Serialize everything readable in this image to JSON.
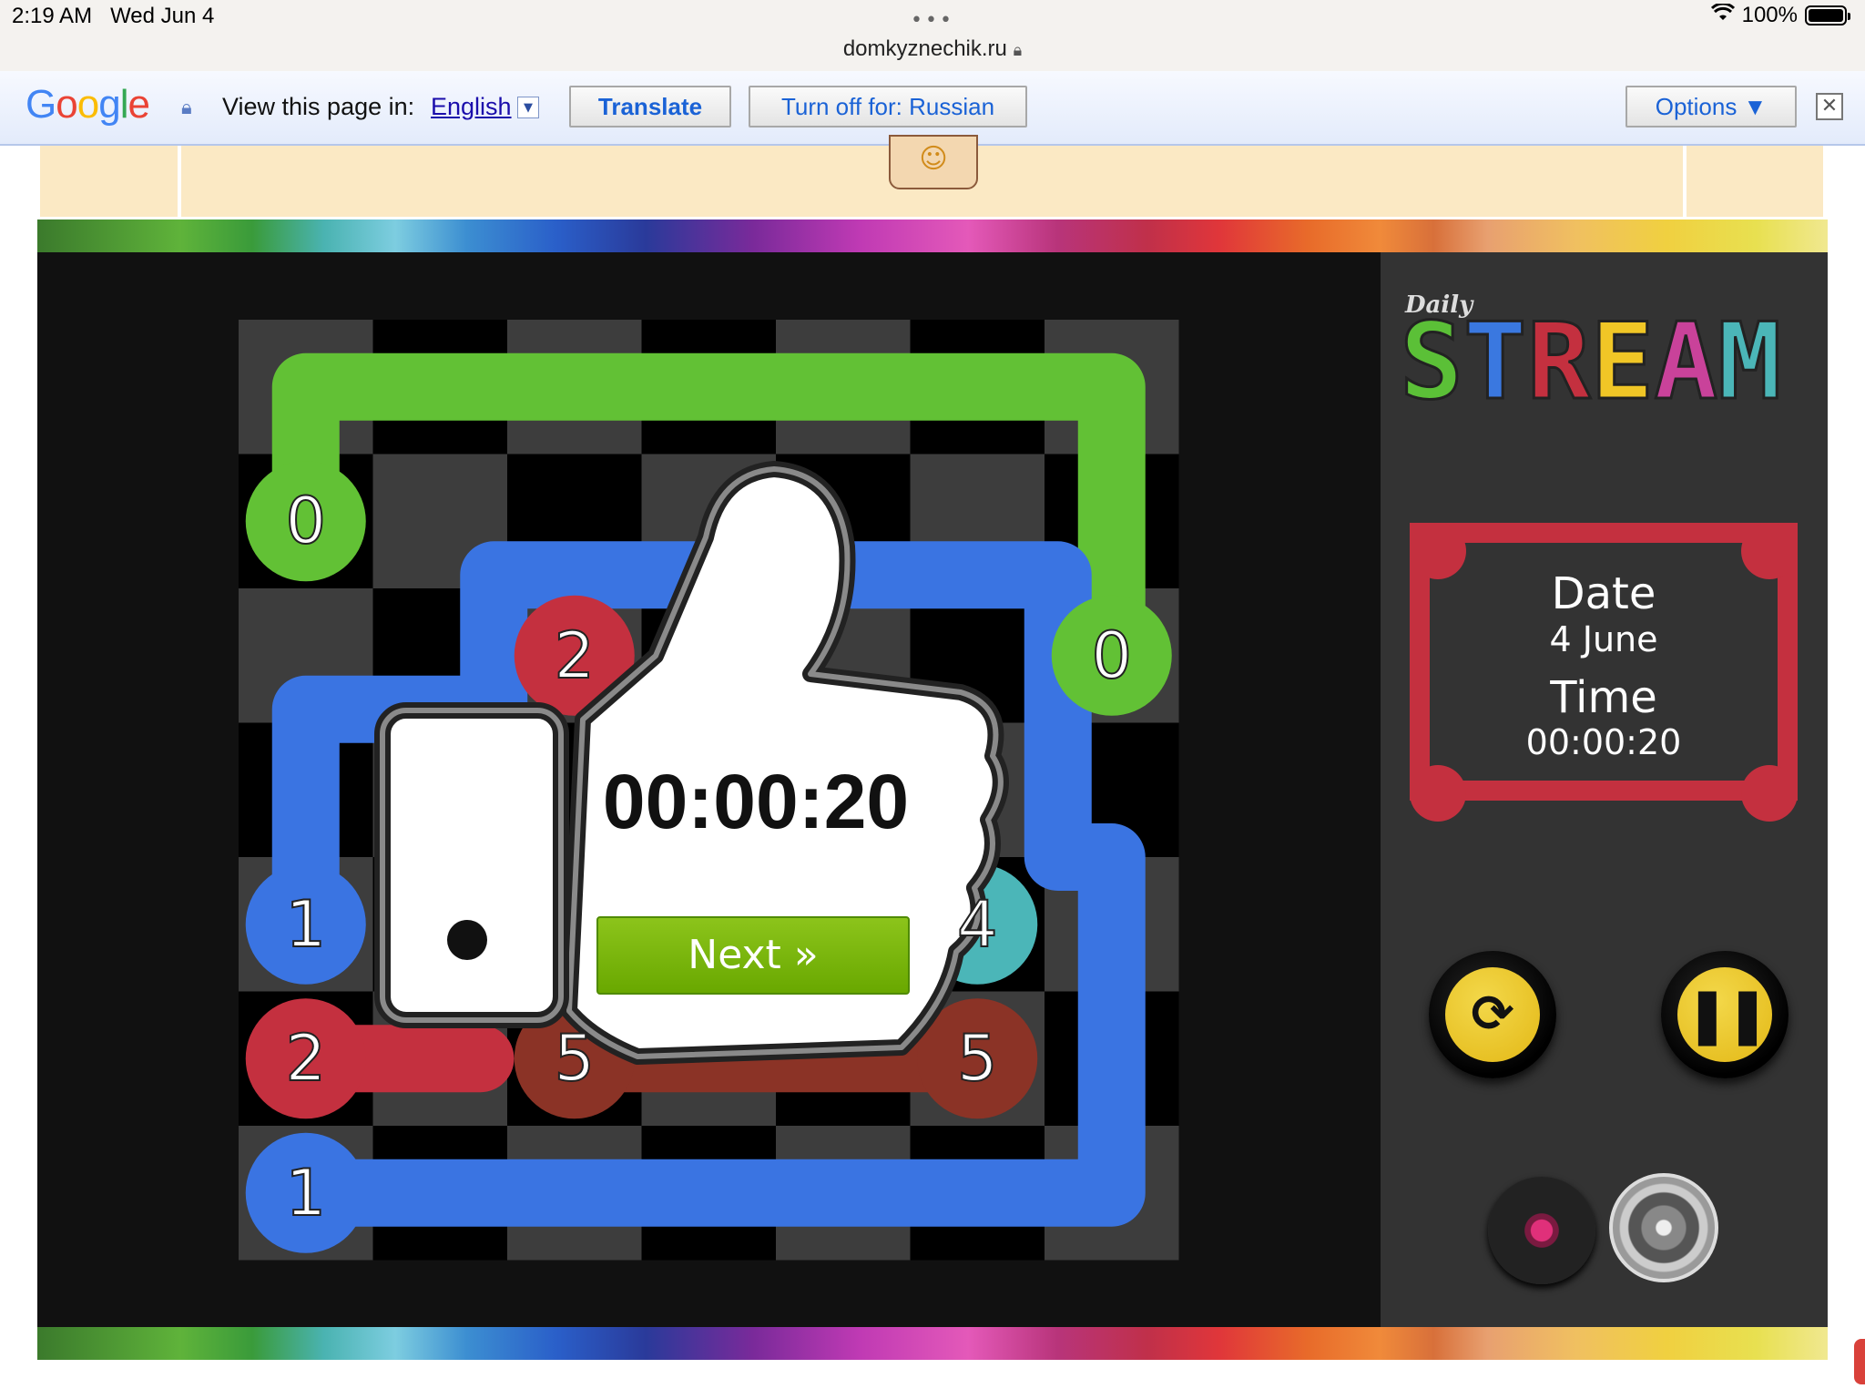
{
  "status_bar": {
    "time": "2:19 AM",
    "date": "Wed Jun 4",
    "url": "domkyznechik.ru",
    "battery": "100%"
  },
  "translate_bar": {
    "view_text": "View this page in:",
    "language": "English",
    "translate_label": "Translate",
    "turn_off_label": "Turn off for: Russian",
    "options_label": "Options ▼",
    "close_label": "✕"
  },
  "game": {
    "logo_small": "Daily",
    "logo_big": [
      "S",
      "T",
      "R",
      "E",
      "A",
      "M"
    ],
    "logo_colors": [
      "#5bc037",
      "#3a78e0",
      "#c4303f",
      "#f0c626",
      "#c9429a",
      "#4bb6b8"
    ],
    "date_title": "Date",
    "date_value": "4 June",
    "time_title": "Time",
    "time_value": "00:00:20",
    "popup_time": "00:00:20",
    "next_label": "Next »",
    "grid_size": 7,
    "nodes": [
      {
        "label": "0",
        "col": 0,
        "row": 1,
        "color": "#62c135"
      },
      {
        "label": "0",
        "col": 6,
        "row": 2,
        "color": "#62c135"
      },
      {
        "label": "2",
        "col": 2,
        "row": 2,
        "color": "#c4303f"
      },
      {
        "label": "1",
        "col": 0,
        "row": 4,
        "color": "#3a74e2"
      },
      {
        "label": "4",
        "col": 5,
        "row": 4,
        "color": "#4bb6b8"
      },
      {
        "label": "2",
        "col": 0,
        "row": 5,
        "color": "#c4303f"
      },
      {
        "label": "5",
        "col": 2,
        "row": 5,
        "color": "#8b3326"
      },
      {
        "label": "5",
        "col": 5,
        "row": 5,
        "color": "#8b3326"
      },
      {
        "label": "1",
        "col": 0,
        "row": 6,
        "color": "#3a74e2"
      }
    ],
    "colors": {
      "green": "#62c135",
      "blue": "#3a74e2",
      "red": "#c4303f",
      "brown": "#8b3326",
      "teal": "#4bb6b8",
      "accent_yellow": "#e9c11d"
    }
  }
}
